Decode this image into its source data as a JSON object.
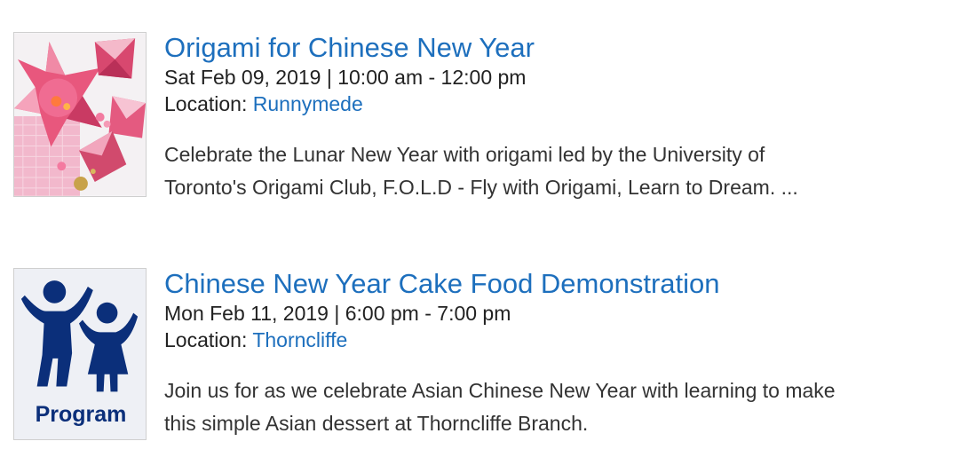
{
  "events": [
    {
      "title": "Origami for Chinese New Year",
      "datetime": "Sat Feb 09, 2019 | 10:00 am - 12:00 pm",
      "location_label": "Location:",
      "location": "Runnymede",
      "description_line1": "Celebrate the Lunar New Year with origami led by the University of",
      "description_line2": "Toronto's Origami Club, F.O.L.D - Fly with Origami, Learn to Dream. ...",
      "image": "origami-photo"
    },
    {
      "title": "Chinese New Year Cake Food Demonstration",
      "datetime": "Mon Feb 11, 2019 | 6:00 pm - 7:00 pm",
      "location_label": "Location:",
      "location": "Thorncliffe",
      "description_line1": "Join us for as we celebrate Asian Chinese New Year with learning to make",
      "description_line2": "this simple Asian dessert at Thorncliffe Branch.",
      "image_label": "Program",
      "image": "program-icon"
    }
  ],
  "colors": {
    "link": "#1d6fbd",
    "program_icon": "#0b2f7a",
    "program_bg": "#eef0f5"
  }
}
